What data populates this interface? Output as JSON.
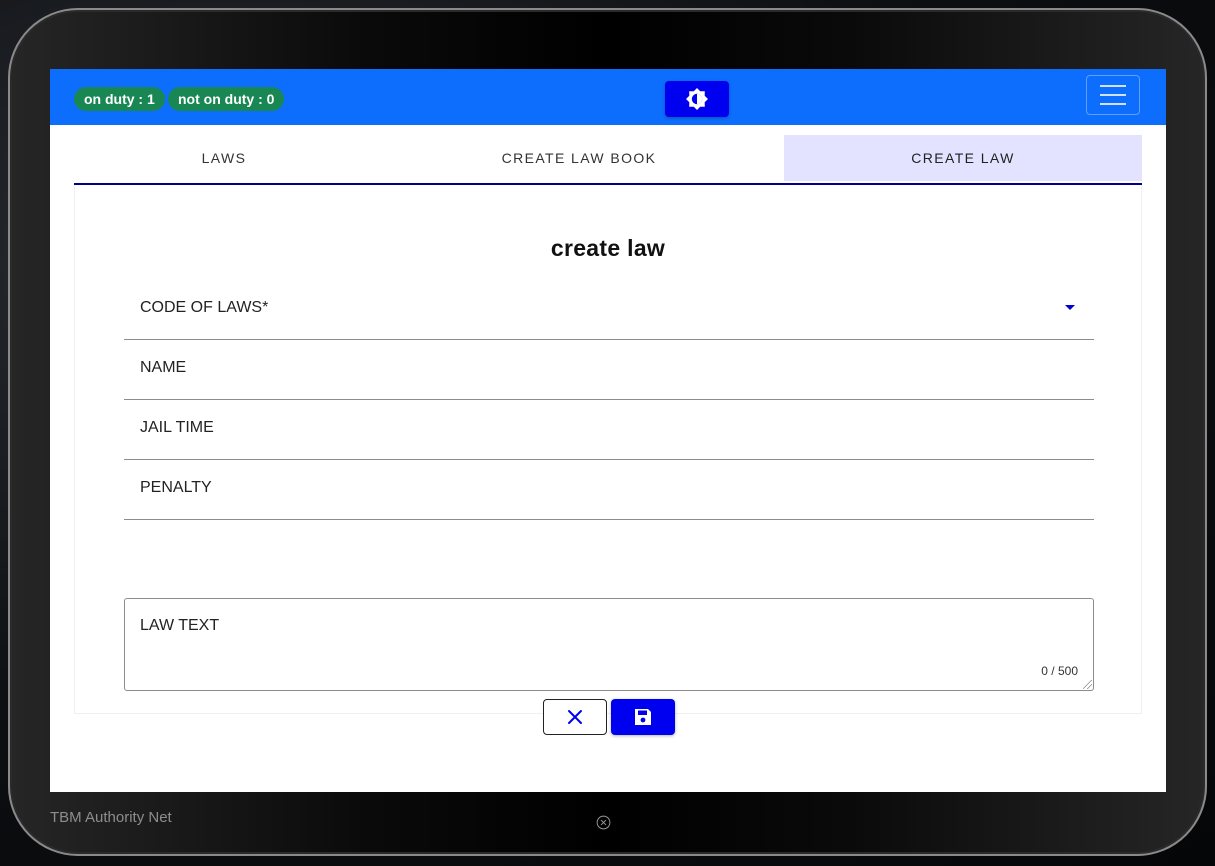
{
  "header": {
    "on_duty": "on duty : 1",
    "not_on_duty": "not on duty : 0",
    "theme_icon": "brightness-icon",
    "menu_icon": "hamburger-menu-icon"
  },
  "tabs": [
    {
      "label": "LAWS",
      "active": false
    },
    {
      "label": "CREATE LAW BOOK",
      "active": false
    },
    {
      "label": "CREATE LAW",
      "active": true
    }
  ],
  "form": {
    "title": "create law",
    "code_of_laws": {
      "label": "CODE OF LAWS*"
    },
    "name": {
      "label": "NAME"
    },
    "jail_time": {
      "label": "JAIL TIME"
    },
    "penalty": {
      "label": "PENALTY"
    },
    "law_text": {
      "label": "LAW TEXT",
      "counter": "0 / 500"
    },
    "cancel_icon": "close-icon",
    "save_icon": "floppy-disk-icon"
  },
  "footer": {
    "app_name": "TBM Authority Net",
    "close_icon": "circle-close-icon"
  },
  "colors": {
    "topbar": "#0d6efd",
    "badge": "#198754",
    "primary_button": "#0000f0",
    "active_tab": "#e3e3ff",
    "tab_underline": "#00008b"
  }
}
